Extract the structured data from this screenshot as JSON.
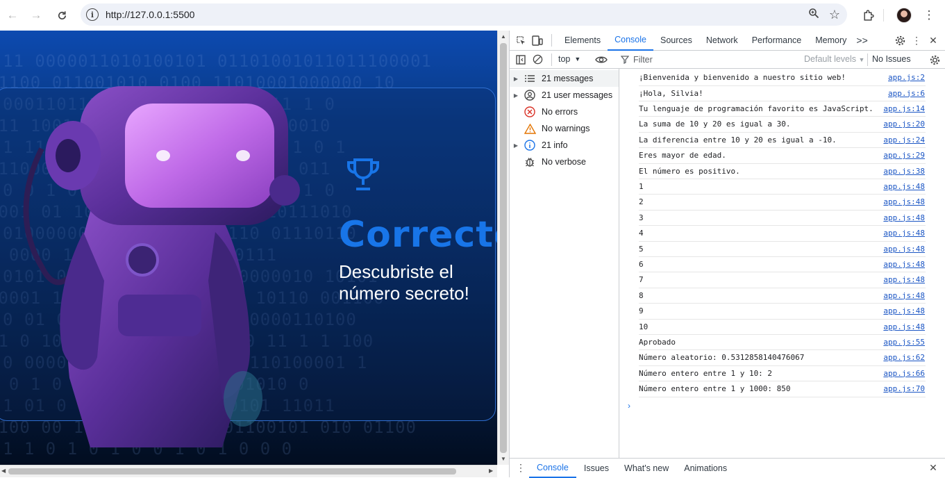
{
  "browser": {
    "url": "http://127.0.0.1:5500"
  },
  "page": {
    "heading": "Correcto",
    "subtitle": "Descubriste el número secreto!",
    "binary_rows": [
      "11 0000011010100101 01101001011011100001",
      "01100 011001010  0100 11010001000000 10",
      "0001101110000011000  0011011 1 0",
      "011  1001 1011100  1 1011101000010",
      "1 11 01101 100 0101 0111 0 1 0 1",
      "011000101011 01101 01110 000 011",
      "0 0 1 0 000001 110010 0 011 1 0",
      "0001 01 10 1000101011001 110111010",
      "010000000 01 1101 1 0110 01110110",
      "0 0000 1 1 1  0  1011 1110111",
      "0101 01 1001000 01 01 0000010 10101",
      "10001 1 0 0000 10110 0 1 10110 001100",
      "0 01 001 00 0 110 01 010000110100",
      "01 0 1001010010 1 0111 10 11 1 1 100",
      "0 0000 1 0110 000 00011110100001 1",
      "1 0 1 0  11100 0 0 11 0001010 0",
      "1 01 0 1 010 1001 0000101 11011",
      "0100 00 11 101101000 101100101 010 01100",
      "1 1  0 1 0 1 0  0 1 0 1 0 0 0"
    ]
  },
  "devtools": {
    "tabs": [
      "Elements",
      "Console",
      "Sources",
      "Network",
      "Performance",
      "Memory"
    ],
    "active_tab": "Console",
    "more_tabs": ">>",
    "context": "top",
    "filter_placeholder": "Filter",
    "levels": "Default levels",
    "issues": "No Issues",
    "sidebar": [
      {
        "label": "21 messages",
        "icon": "list-icon",
        "expandable": true
      },
      {
        "label": "21 user messages",
        "icon": "user-circle-icon",
        "expandable": true
      },
      {
        "label": "No errors",
        "icon": "error-icon",
        "expandable": false
      },
      {
        "label": "No warnings",
        "icon": "warning-icon",
        "expandable": false
      },
      {
        "label": "21 info",
        "icon": "info-icon",
        "expandable": true
      },
      {
        "label": "No verbose",
        "icon": "bug-icon",
        "expandable": false
      }
    ],
    "console_messages": [
      {
        "text": "¡Bienvenida y bienvenido a nuestro sitio web!",
        "source": "app.js:2"
      },
      {
        "text": "¡Hola, Silvia!",
        "source": "app.js:6"
      },
      {
        "text": "Tu lenguaje de programación favorito es JavaScript.",
        "source": "app.js:14"
      },
      {
        "text": "La suma de 10 y 20 es igual a 30.",
        "source": "app.js:20"
      },
      {
        "text": "La diferencia entre 10 y 20 es igual a -10.",
        "source": "app.js:24"
      },
      {
        "text": "Eres mayor de edad.",
        "source": "app.js:29"
      },
      {
        "text": "El número es positivo.",
        "source": "app.js:38"
      },
      {
        "text": "1",
        "source": "app.js:48"
      },
      {
        "text": "2",
        "source": "app.js:48"
      },
      {
        "text": "3",
        "source": "app.js:48"
      },
      {
        "text": "4",
        "source": "app.js:48"
      },
      {
        "text": "5",
        "source": "app.js:48"
      },
      {
        "text": "6",
        "source": "app.js:48"
      },
      {
        "text": "7",
        "source": "app.js:48"
      },
      {
        "text": "8",
        "source": "app.js:48"
      },
      {
        "text": "9",
        "source": "app.js:48"
      },
      {
        "text": "10",
        "source": "app.js:48"
      },
      {
        "text": "Aprobado",
        "source": "app.js:55"
      },
      {
        "text": "Número aleatorio: 0.5312858140476067",
        "source": "app.js:62"
      },
      {
        "text": "Número entero entre 1 y 10: 2",
        "source": "app.js:66"
      },
      {
        "text": "Número entero entre 1 y 1000: 850",
        "source": "app.js:70"
      }
    ],
    "prompt": "›",
    "drawer_tabs": [
      "Console",
      "Issues",
      "What's new",
      "Animations"
    ],
    "drawer_active": "Console"
  }
}
